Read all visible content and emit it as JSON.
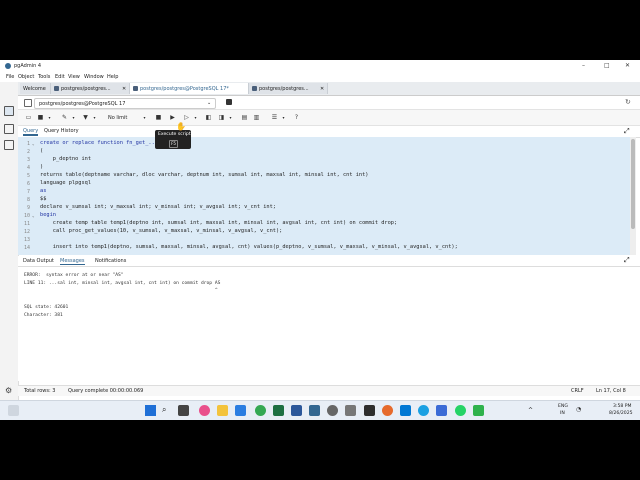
{
  "window": {
    "title": "pgAdmin 4",
    "controls": [
      "–",
      "□",
      "✕"
    ]
  },
  "menu": [
    "File",
    "Object",
    "Tools",
    "Edit",
    "View",
    "Window",
    "Help"
  ],
  "tabs": [
    {
      "label": "Welcome"
    },
    {
      "label": "postgres/postgres..."
    },
    {
      "label": "postgres/postgres@PostgreSQL 17*"
    },
    {
      "label": "postgres/postgres..."
    }
  ],
  "connection": {
    "label": "postgres/postgres@PostgreSQL 17"
  },
  "toolbar": {
    "limit_label": "No limit"
  },
  "tooltip": {
    "title": "Execute script",
    "shortcut": "F5"
  },
  "query_tabs": [
    "Query",
    "Query History"
  ],
  "editor_lines": [
    {
      "n": "1",
      "text": "create or replace function fn_get_..."
    },
    {
      "n": "2",
      "text": "("
    },
    {
      "n": "3",
      "text": "    p_deptno int"
    },
    {
      "n": "4",
      "text": ")"
    },
    {
      "n": "5",
      "text": "returns table(deptname varchar, dloc varchar, deptnum int, sumsal int, maxsal int, minsal int, cnt int)"
    },
    {
      "n": "6",
      "text": "language plpgsql"
    },
    {
      "n": "7",
      "text": "as"
    },
    {
      "n": "8",
      "text": "$$"
    },
    {
      "n": "9",
      "text": "declare v_sumsal int; v_maxsal int; v_minsal int; v_avgsal int; v_cnt int;"
    },
    {
      "n": "10",
      "text": "begin"
    },
    {
      "n": "11",
      "text": "    create temp table temp1(deptno int, sumsal int, maxsal int, minsal int, avgsal int, cnt int) on commit drop;"
    },
    {
      "n": "12",
      "text": "    call proc_get_values(10, v_sumsal, v_maxsal, v_minsal, v_avgsal, v_cnt);"
    },
    {
      "n": "13",
      "text": ""
    },
    {
      "n": "14",
      "text": "    insert into temp1(deptno, sumsal, maxsal, minsal, avgsal, cnt) values(p_deptno, v_sumsal, v_maxsal, v_minsal, v_avgsal, v_cnt);"
    }
  ],
  "bottom_tabs": [
    "Data Output",
    "Messages",
    "Notifications"
  ],
  "messages": [
    "ERROR:  syntax error at or near \"AS\"",
    "LINE 11: ...sal int, minsal int, avgsal int, cnt int) on commit drop AS",
    "                                                                     ^",
    "",
    "SQL state: 42601",
    "Character: 381"
  ],
  "status": {
    "total_rows": "Total rows: 3",
    "query_status": "Query complete 00:00:00.069",
    "eol": "CRLF",
    "position": "Ln 17, Col 8"
  },
  "taskbar": {
    "lang_top": "ENG",
    "lang_bottom": "IN",
    "time": "3:58 PM",
    "date": "8/26/2025"
  },
  "colors": {
    "accent": "#326690",
    "editor_bg": "#dcebf7",
    "taskbar_bg": "#e8eef6"
  }
}
